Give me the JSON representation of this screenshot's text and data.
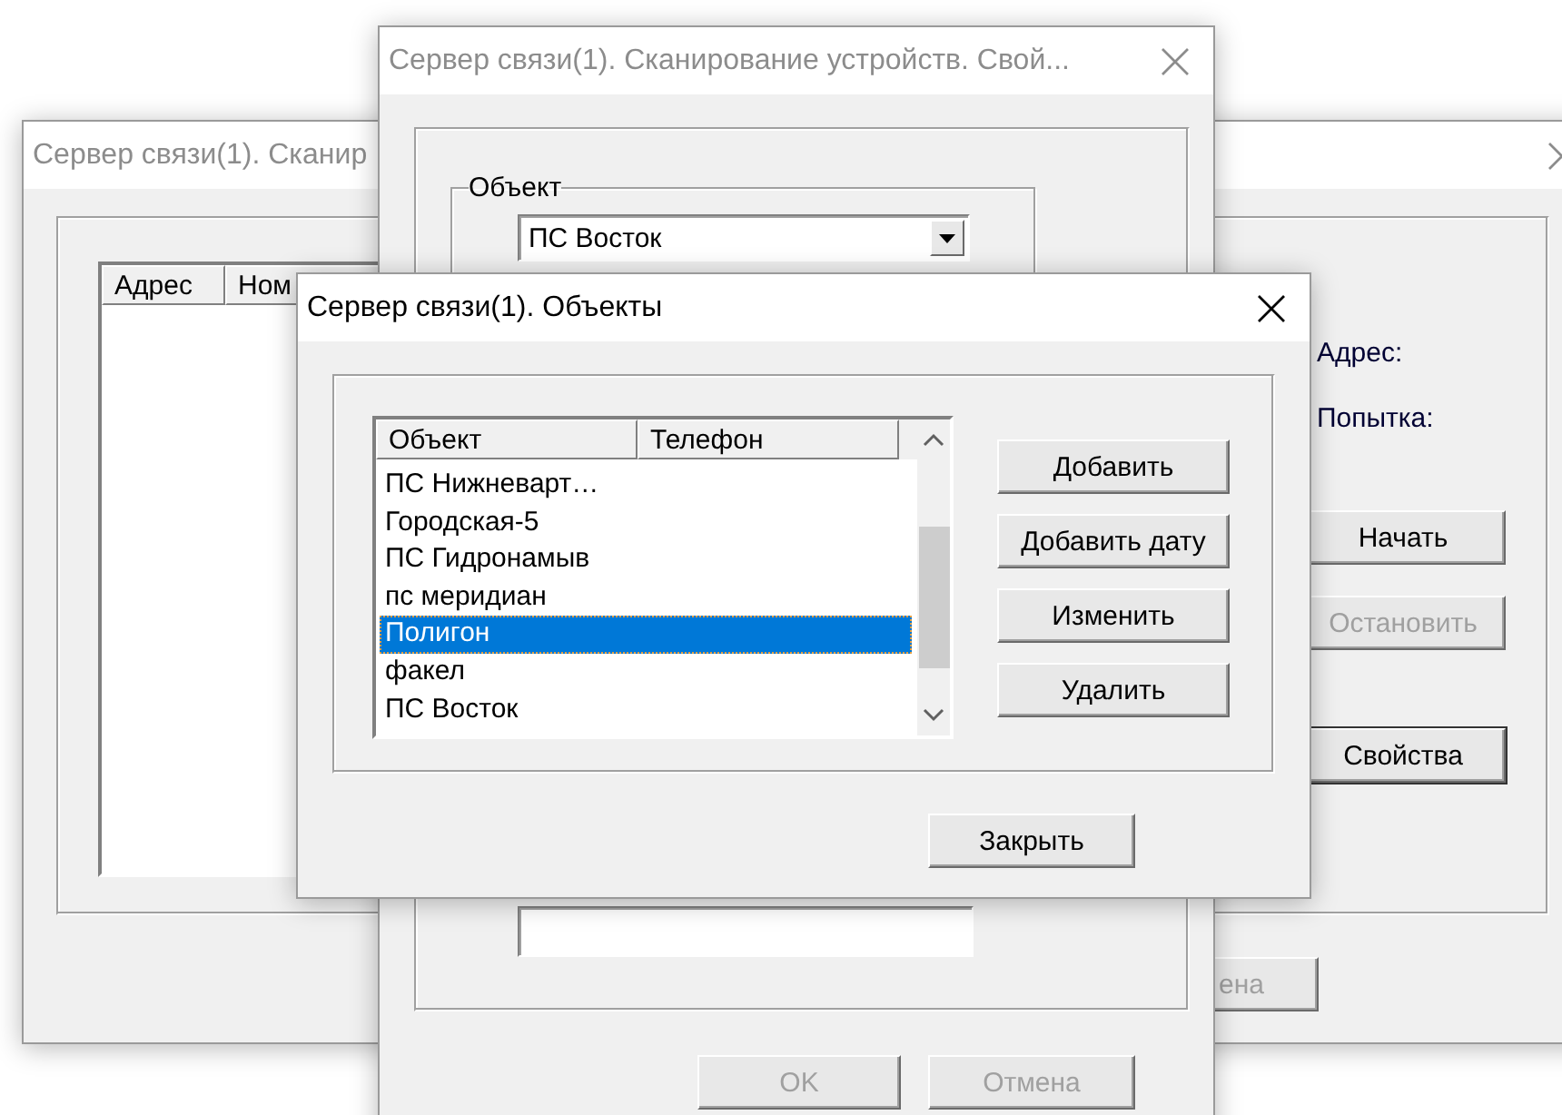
{
  "scan_window": {
    "title": "Сервер связи(1). Сканир",
    "active": false,
    "list_columns": [
      "Адрес",
      "Ном"
    ],
    "labels": [
      "Адрес:",
      "Попытка:"
    ],
    "buttons": [
      {
        "label": "Начать",
        "disabled": false,
        "default": false
      },
      {
        "label": "Остановить",
        "disabled": true,
        "default": false
      },
      {
        "label": "Свойства",
        "disabled": false,
        "default": true
      }
    ],
    "bottom_button": {
      "label": "ена",
      "disabled": true
    }
  },
  "properties_window": {
    "title": "Сервер связи(1). Сканирование устройств. Свой...",
    "active": false,
    "group_label": "Объект",
    "object_combo": {
      "value": "ПС Восток"
    },
    "buttons": [
      {
        "label": "OK",
        "disabled": true
      },
      {
        "label": "Отмена",
        "disabled": true
      }
    ]
  },
  "objects_window": {
    "title": "Сервер связи(1). Объекты",
    "active": true,
    "columns": [
      "Объект",
      "Телефон"
    ],
    "rows": [
      {
        "name": "ПС Нижневарт…",
        "selected": false
      },
      {
        "name": "Городская-5",
        "selected": false
      },
      {
        "name": "ПС Гидронамыв",
        "selected": false
      },
      {
        "name": "пс меридиан",
        "selected": false
      },
      {
        "name": "Полигон",
        "selected": true
      },
      {
        "name": "факел",
        "selected": false
      },
      {
        "name": "ПС Восток",
        "selected": false
      }
    ],
    "side_buttons": [
      "Добавить",
      "Добавить дату",
      "Изменить",
      "Удалить"
    ],
    "close_button": "Закрыть"
  }
}
